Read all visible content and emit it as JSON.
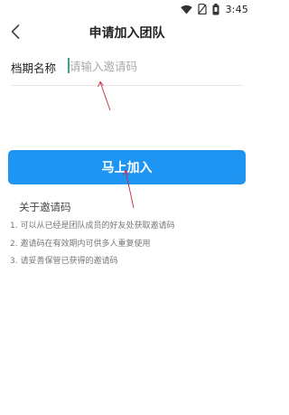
{
  "status_bar": {
    "time": "3:45",
    "icons": [
      "wifi-icon",
      "no-sim-icon",
      "battery-icon"
    ]
  },
  "nav": {
    "back_icon": "chevron-left-icon",
    "title": "申请加入团队"
  },
  "form": {
    "label": "档期名称",
    "input_placeholder": "请输入邀请码",
    "input_value": ""
  },
  "button": {
    "label": "马上加入",
    "color": "#1e95f2"
  },
  "about": {
    "title": "关于邀请码",
    "items": [
      "1. 可以从已经是团队成员的好友处获取邀请码",
      "2. 邀请码在有效期内可供多人重复使用",
      "3. 请妥善保管已获得的邀请码"
    ]
  },
  "colors": {
    "accent": "#1e95f2",
    "annotation": "#c8283c",
    "caret": "#3ba58f"
  }
}
